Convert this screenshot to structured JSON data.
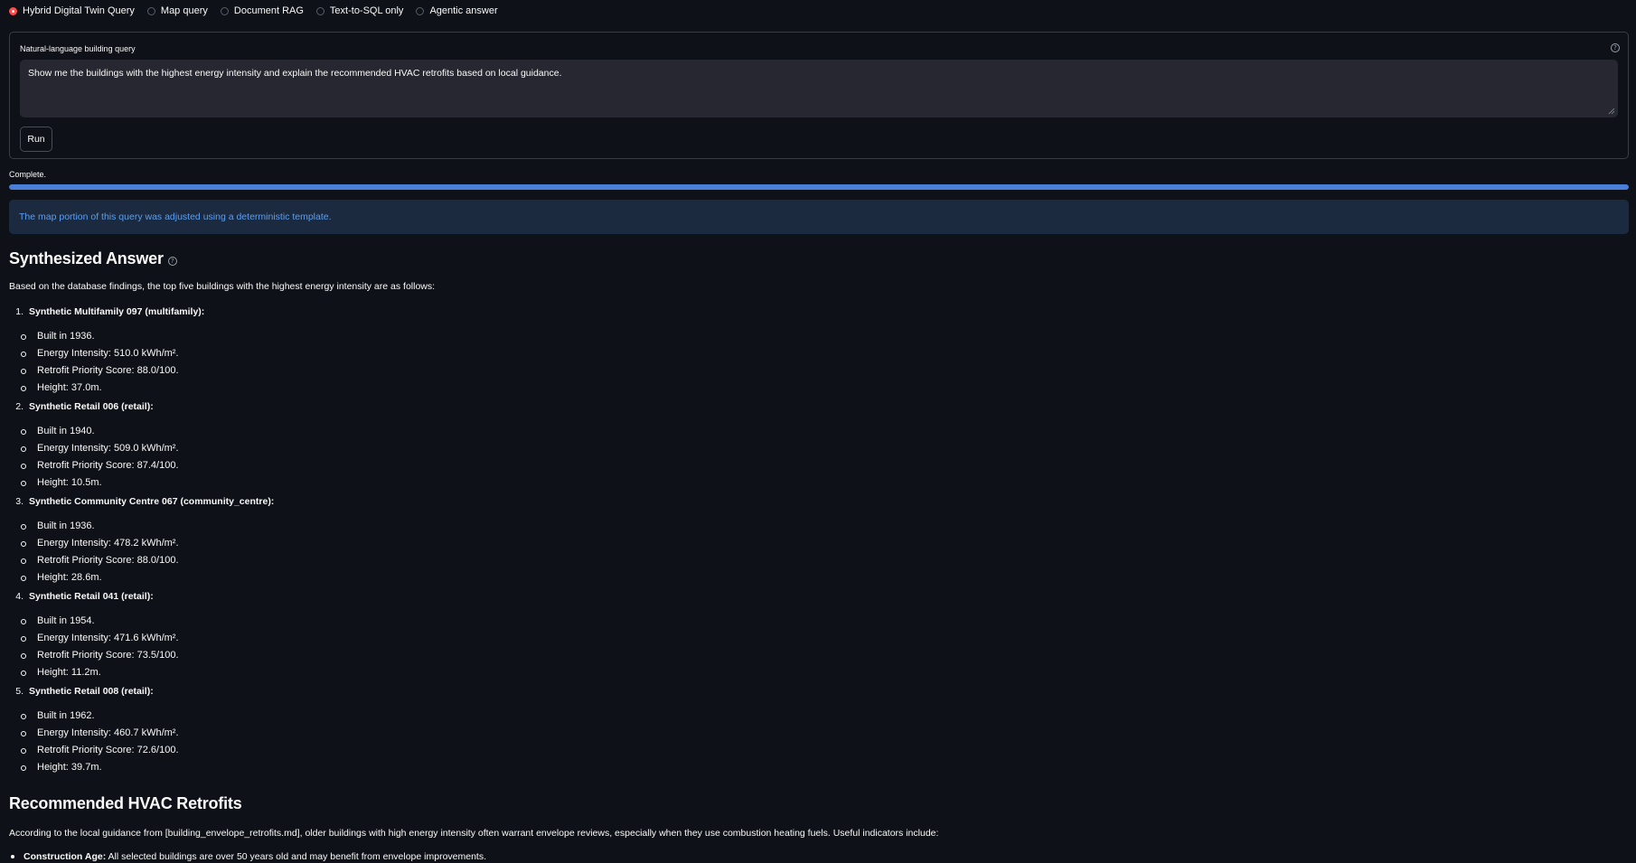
{
  "mode_options": [
    {
      "label": "Hybrid Digital Twin Query",
      "selected": true
    },
    {
      "label": "Map query",
      "selected": false
    },
    {
      "label": "Document RAG",
      "selected": false
    },
    {
      "label": "Text-to-SQL only",
      "selected": false
    },
    {
      "label": "Agentic answer",
      "selected": false
    }
  ],
  "query": {
    "label": "Natural-language building query",
    "value": "Show me the buildings with the highest energy intensity and explain the recommended HVAC retrofits based on local guidance.",
    "help_icon": "question-circle-icon",
    "run_label": "Run"
  },
  "status": {
    "text": "Complete.",
    "progress": 1.0,
    "progress_color": "#4a7fd9"
  },
  "info_message": "The map portion of this query was adjusted using a deterministic template.",
  "answer": {
    "heading": "Synthesized Answer",
    "intro": "Based on the database findings, the top five buildings with the highest energy intensity are as follows:",
    "buildings": [
      {
        "num": "1.",
        "title": "Synthetic Multifamily 097 (multifamily):",
        "facts": [
          "Built in 1936.",
          "Energy Intensity: 510.0 kWh/m².",
          "Retrofit Priority Score: 88.0/100.",
          "Height: 37.0m."
        ]
      },
      {
        "num": "2.",
        "title": "Synthetic Retail 006 (retail):",
        "facts": [
          "Built in 1940.",
          "Energy Intensity: 509.0 kWh/m².",
          "Retrofit Priority Score: 87.4/100.",
          "Height: 10.5m."
        ]
      },
      {
        "num": "3.",
        "title": "Synthetic Community Centre 067 (community_centre):",
        "facts": [
          "Built in 1936.",
          "Energy Intensity: 478.2 kWh/m².",
          "Retrofit Priority Score: 88.0/100.",
          "Height: 28.6m."
        ]
      },
      {
        "num": "4.",
        "title": "Synthetic Retail 041 (retail):",
        "facts": [
          "Built in 1954.",
          "Energy Intensity: 471.6 kWh/m².",
          "Retrofit Priority Score: 73.5/100.",
          "Height: 11.2m."
        ]
      },
      {
        "num": "5.",
        "title": "Synthetic Retail 008 (retail):",
        "facts": [
          "Built in 1962.",
          "Energy Intensity: 460.7 kWh/m².",
          "Retrofit Priority Score: 72.6/100.",
          "Height: 39.7m."
        ]
      }
    ],
    "retrofits_heading": "Recommended HVAC Retrofits",
    "retrofits_intro": "According to the local guidance from [building_envelope_retrofits.md], older buildings with high energy intensity often warrant envelope reviews, especially when they use combustion heating fuels. Useful indicators include:",
    "retrofits_bullet_bold": "Construction Age:",
    "retrofits_bullet_text": " All selected buildings are over 50 years old and may benefit from envelope improvements."
  },
  "colors": {
    "background": "#0e1117",
    "accent": "#ff4b4b",
    "info_bg": "#1c2a3f",
    "info_text": "#5b9ef0"
  }
}
